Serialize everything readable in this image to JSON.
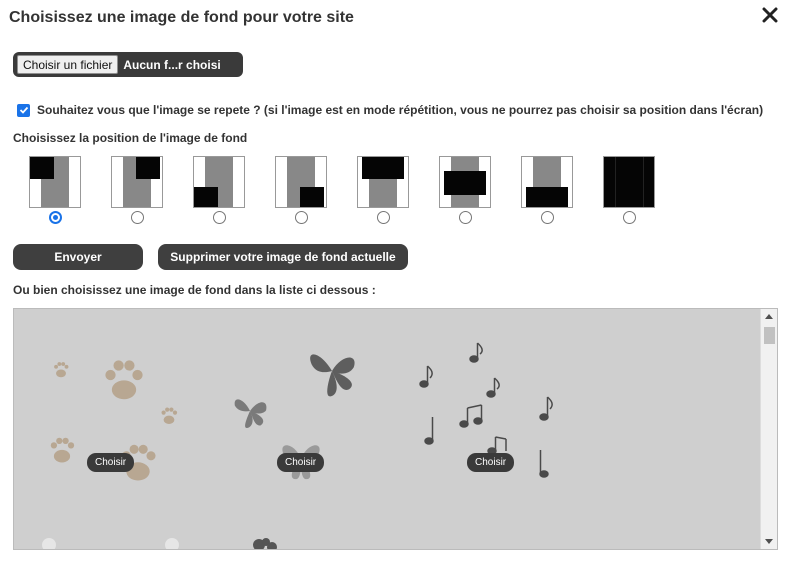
{
  "dialog": {
    "title": "Choisissez une image de fond pour votre site",
    "close_icon": "close-icon"
  },
  "file_input": {
    "button_label": "Choisir un fichier",
    "status": "Aucun f...r choisi"
  },
  "repeat": {
    "checked": true,
    "label": "Souhaitez vous que l'image se repete ? (si l'image est en mode répétition, vous ne pourrez pas choisir sa position dans l'écran)"
  },
  "position": {
    "label": "Choisissez la position de l'image de fond",
    "selected_index": 0,
    "options": [
      "top-left",
      "top-right",
      "bottom-left",
      "bottom-right",
      "top-center",
      "center",
      "bottom-center",
      "full"
    ]
  },
  "actions": {
    "send_label": "Envoyer",
    "remove_label": "Supprimer votre image de fond actuelle"
  },
  "gallery": {
    "label": "Ou bien choisissez une image de fond dans la liste ci dessous :",
    "choose_label": "Choisir",
    "items": [
      {
        "name": "paws",
        "choose_label": "Choisir"
      },
      {
        "name": "butterflies",
        "choose_label": "Choisir"
      },
      {
        "name": "music-notes",
        "choose_label": "Choisir"
      }
    ]
  },
  "colors": {
    "accent": "#1a73e8",
    "dark_button": "#3f3f3f",
    "gallery_bg": "#cfcfcf"
  }
}
